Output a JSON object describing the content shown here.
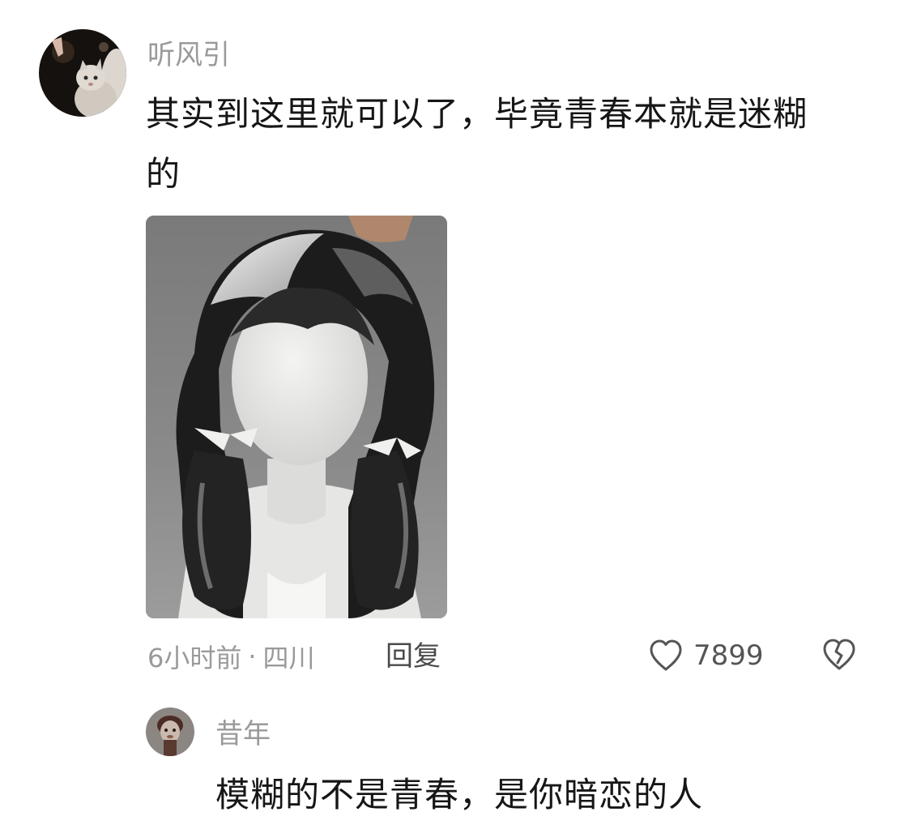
{
  "comment": {
    "username": "听风引",
    "avatar_icon": "cat-avatar-icon",
    "text_line1": "其实到这里就可以了，毕竟青春本就是迷糊",
    "text_line2": "的",
    "image_icon": "faceless-girl-drawing-icon",
    "meta": {
      "time": "6小时前",
      "separator": "·",
      "location": "四川"
    },
    "reply_label": "回复",
    "likes": "7899",
    "like_icon": "heart-icon",
    "dislike_icon": "broken-heart-icon"
  },
  "reply": {
    "username": "昔年",
    "avatar_icon": "figure-avatar-icon",
    "text": "模糊的不是青春，是你暗恋的人"
  },
  "colors": {
    "username": "#9a9a9a",
    "text": "#161616",
    "meta": "#9a9a9a",
    "background": "#ffffff"
  }
}
